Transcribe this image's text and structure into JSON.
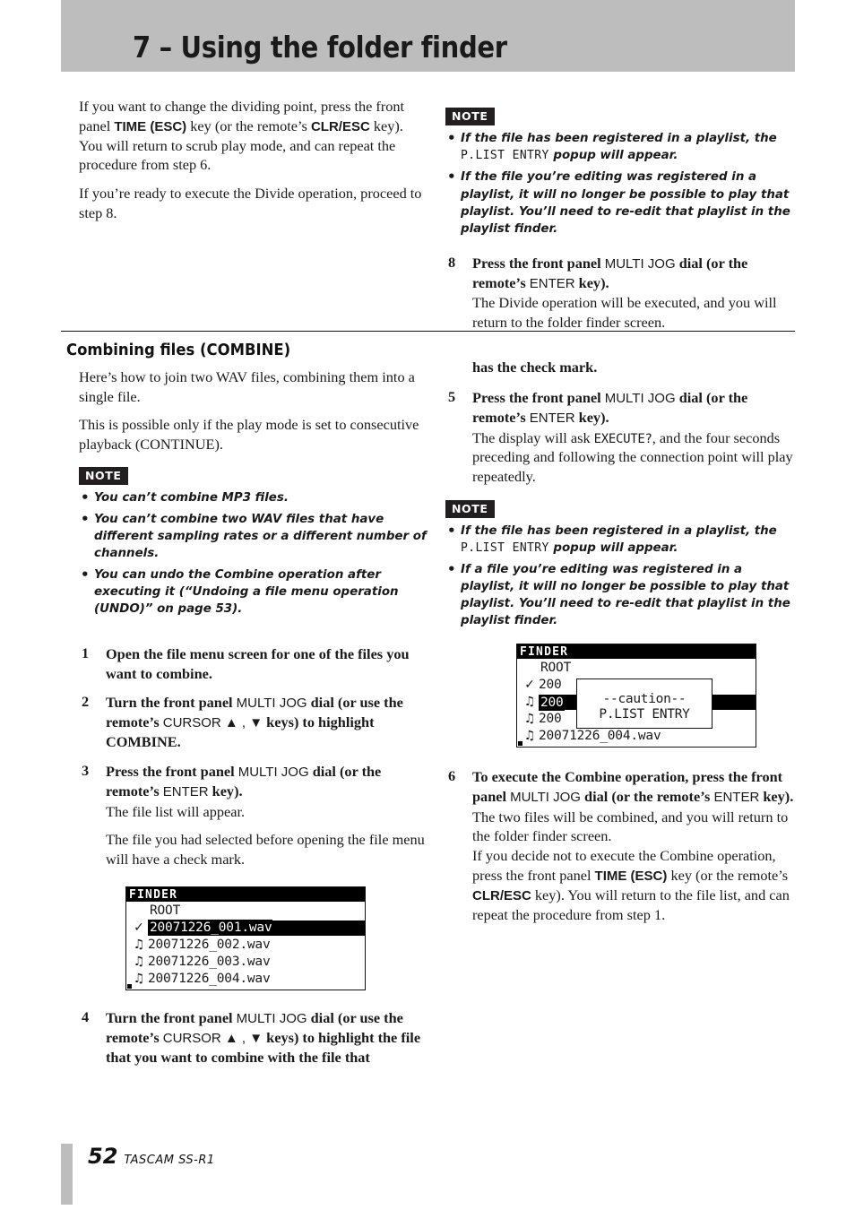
{
  "header": {
    "title": "7 – Using the folder finder"
  },
  "footer": {
    "page_number": "52",
    "model": "TASCAM  SS-R1"
  },
  "left_column": {
    "para1_a": "If you want to change the dividing point, press the front panel ",
    "para1_key1": "TIME (ESC)",
    "para1_b": " key (or the remote’s ",
    "para1_key2": "CLR/ESC",
    "para1_c": " key). You will return to scrub play mode, and can repeat the procedure from step 6.",
    "para2": "If you’re ready to execute the Divide operation, proceed to step 8.",
    "section_heading": "Combining files (COMBINE)",
    "intro1": "Here’s how to join two WAV files, combining them into a single file.",
    "intro2": "This is possible only if the play mode is set to consecutive playback (CONTINUE).",
    "note_label": "NOTE",
    "notes": [
      "You can’t combine MP3 files.",
      "You can’t combine two WAV files that have different sampling rates or a different number of channels.",
      "You can undo the Combine operation after executing it (“Undoing a file menu operation (UNDO)” on page 53)."
    ],
    "steps": [
      {
        "num": "1",
        "lead": "Open the file menu screen for one of the files you want to combine.",
        "subs": []
      },
      {
        "num": "2",
        "lead_pre": "Turn the front panel ",
        "lead_key1": "MULTI JOG",
        "lead_mid": " dial (or use the remote’s ",
        "lead_key2": "CURSOR ▲ , ▼",
        "lead_post": " keys) to highlight COMBINE.",
        "subs": []
      },
      {
        "num": "3",
        "lead_pre": "Press the front panel ",
        "lead_key1": "MULTI JOG",
        "lead_mid": " dial (or the remote’s ",
        "lead_key2": "ENTER",
        "lead_post": " key).",
        "subs": [
          "The file list will appear.",
          "The file you had selected before opening the file menu will have a check mark."
        ]
      },
      {
        "num": "4",
        "lead_pre": "Turn the front panel ",
        "lead_key1": "MULTI JOG",
        "lead_mid": " dial (or use the remote’s ",
        "lead_key2": "CURSOR ▲ , ▼",
        "lead_post": " keys) to highlight the file that you want to combine with the file that",
        "subs": []
      }
    ],
    "lcd": {
      "title": "FINDER",
      "root_label": "ROOT",
      "rows": [
        {
          "icon": "check",
          "name": "20071226_001.wav",
          "highlighted": true
        },
        {
          "icon": "note",
          "name": "20071226_002.wav",
          "highlighted": false
        },
        {
          "icon": "note",
          "name": "20071226_003.wav",
          "highlighted": false
        },
        {
          "icon": "note",
          "name": "20071226_004.wav",
          "highlighted": false
        }
      ]
    }
  },
  "right_column": {
    "note_label_1": "NOTE",
    "notes_1_a_pre": "If the file has been registered in a playlist, the ",
    "notes_1_a_mono": "P.LIST ENTRY",
    "notes_1_a_post": " popup will appear.",
    "notes_1_b": "If the file you’re editing was registered in a playlist, it will no longer be possible to play that playlist. You’ll need to re-edit that playlist in the playlist finder.",
    "step8": {
      "num": "8",
      "lead_pre": "Press the front panel ",
      "lead_key1": "MULTI JOG",
      "lead_mid": " dial (or the remote’s ",
      "lead_key2": "ENTER",
      "lead_post": " key).",
      "sub": "The Divide operation will be executed, and you will return to the folder finder screen."
    },
    "continued_lead": "has the check mark.",
    "step5": {
      "num": "5",
      "lead_pre": "Press the front panel ",
      "lead_key1": "MULTI JOG",
      "lead_mid": " dial (or the remote’s ",
      "lead_key2": "ENTER",
      "lead_post": " key).",
      "sub_pre": "The display will ask ",
      "sub_mono": "EXECUTE?",
      "sub_post": ", and the four seconds preceding and following the connection point will play repeatedly."
    },
    "note_label_2": "NOTE",
    "notes_2_a_pre": "If the file has been registered in a playlist, the ",
    "notes_2_a_mono": "P.LIST ENTRY",
    "notes_2_a_post": " popup will appear.",
    "notes_2_b": "If a file you’re editing was registered in a playlist, it will no longer be possible to play that playlist. You’ll need to re-edit that playlist in the playlist finder.",
    "lcd": {
      "title": "FINDER",
      "root_label": "ROOT",
      "popup_line1": "--caution--",
      "popup_line2": "P.LIST ENTRY",
      "rows": [
        {
          "icon": "check",
          "name": "200",
          "highlighted": false
        },
        {
          "icon": "note",
          "name": "200",
          "highlighted": true
        },
        {
          "icon": "note",
          "name": "200",
          "highlighted": false
        },
        {
          "icon": "note",
          "name": "20071226_004.wav",
          "highlighted": false
        }
      ]
    },
    "step6": {
      "num": "6",
      "lead_pre": "To execute the Combine operation, press the front panel ",
      "lead_key1": "MULTI JOG",
      "lead_mid": " dial (or the remote’s ",
      "lead_key2": "ENTER",
      "lead_post": " key).",
      "sub1": "The two files will be combined, and you will return to the folder finder screen.",
      "sub2_a": "If you decide not to execute the Combine operation, press the front panel ",
      "sub2_key1": "TIME (ESC)",
      "sub2_b": " key (or the remote’s ",
      "sub2_key2": "CLR/ESC",
      "sub2_c": " key). You will return to the file list, and can repeat the procedure from step 1."
    }
  }
}
